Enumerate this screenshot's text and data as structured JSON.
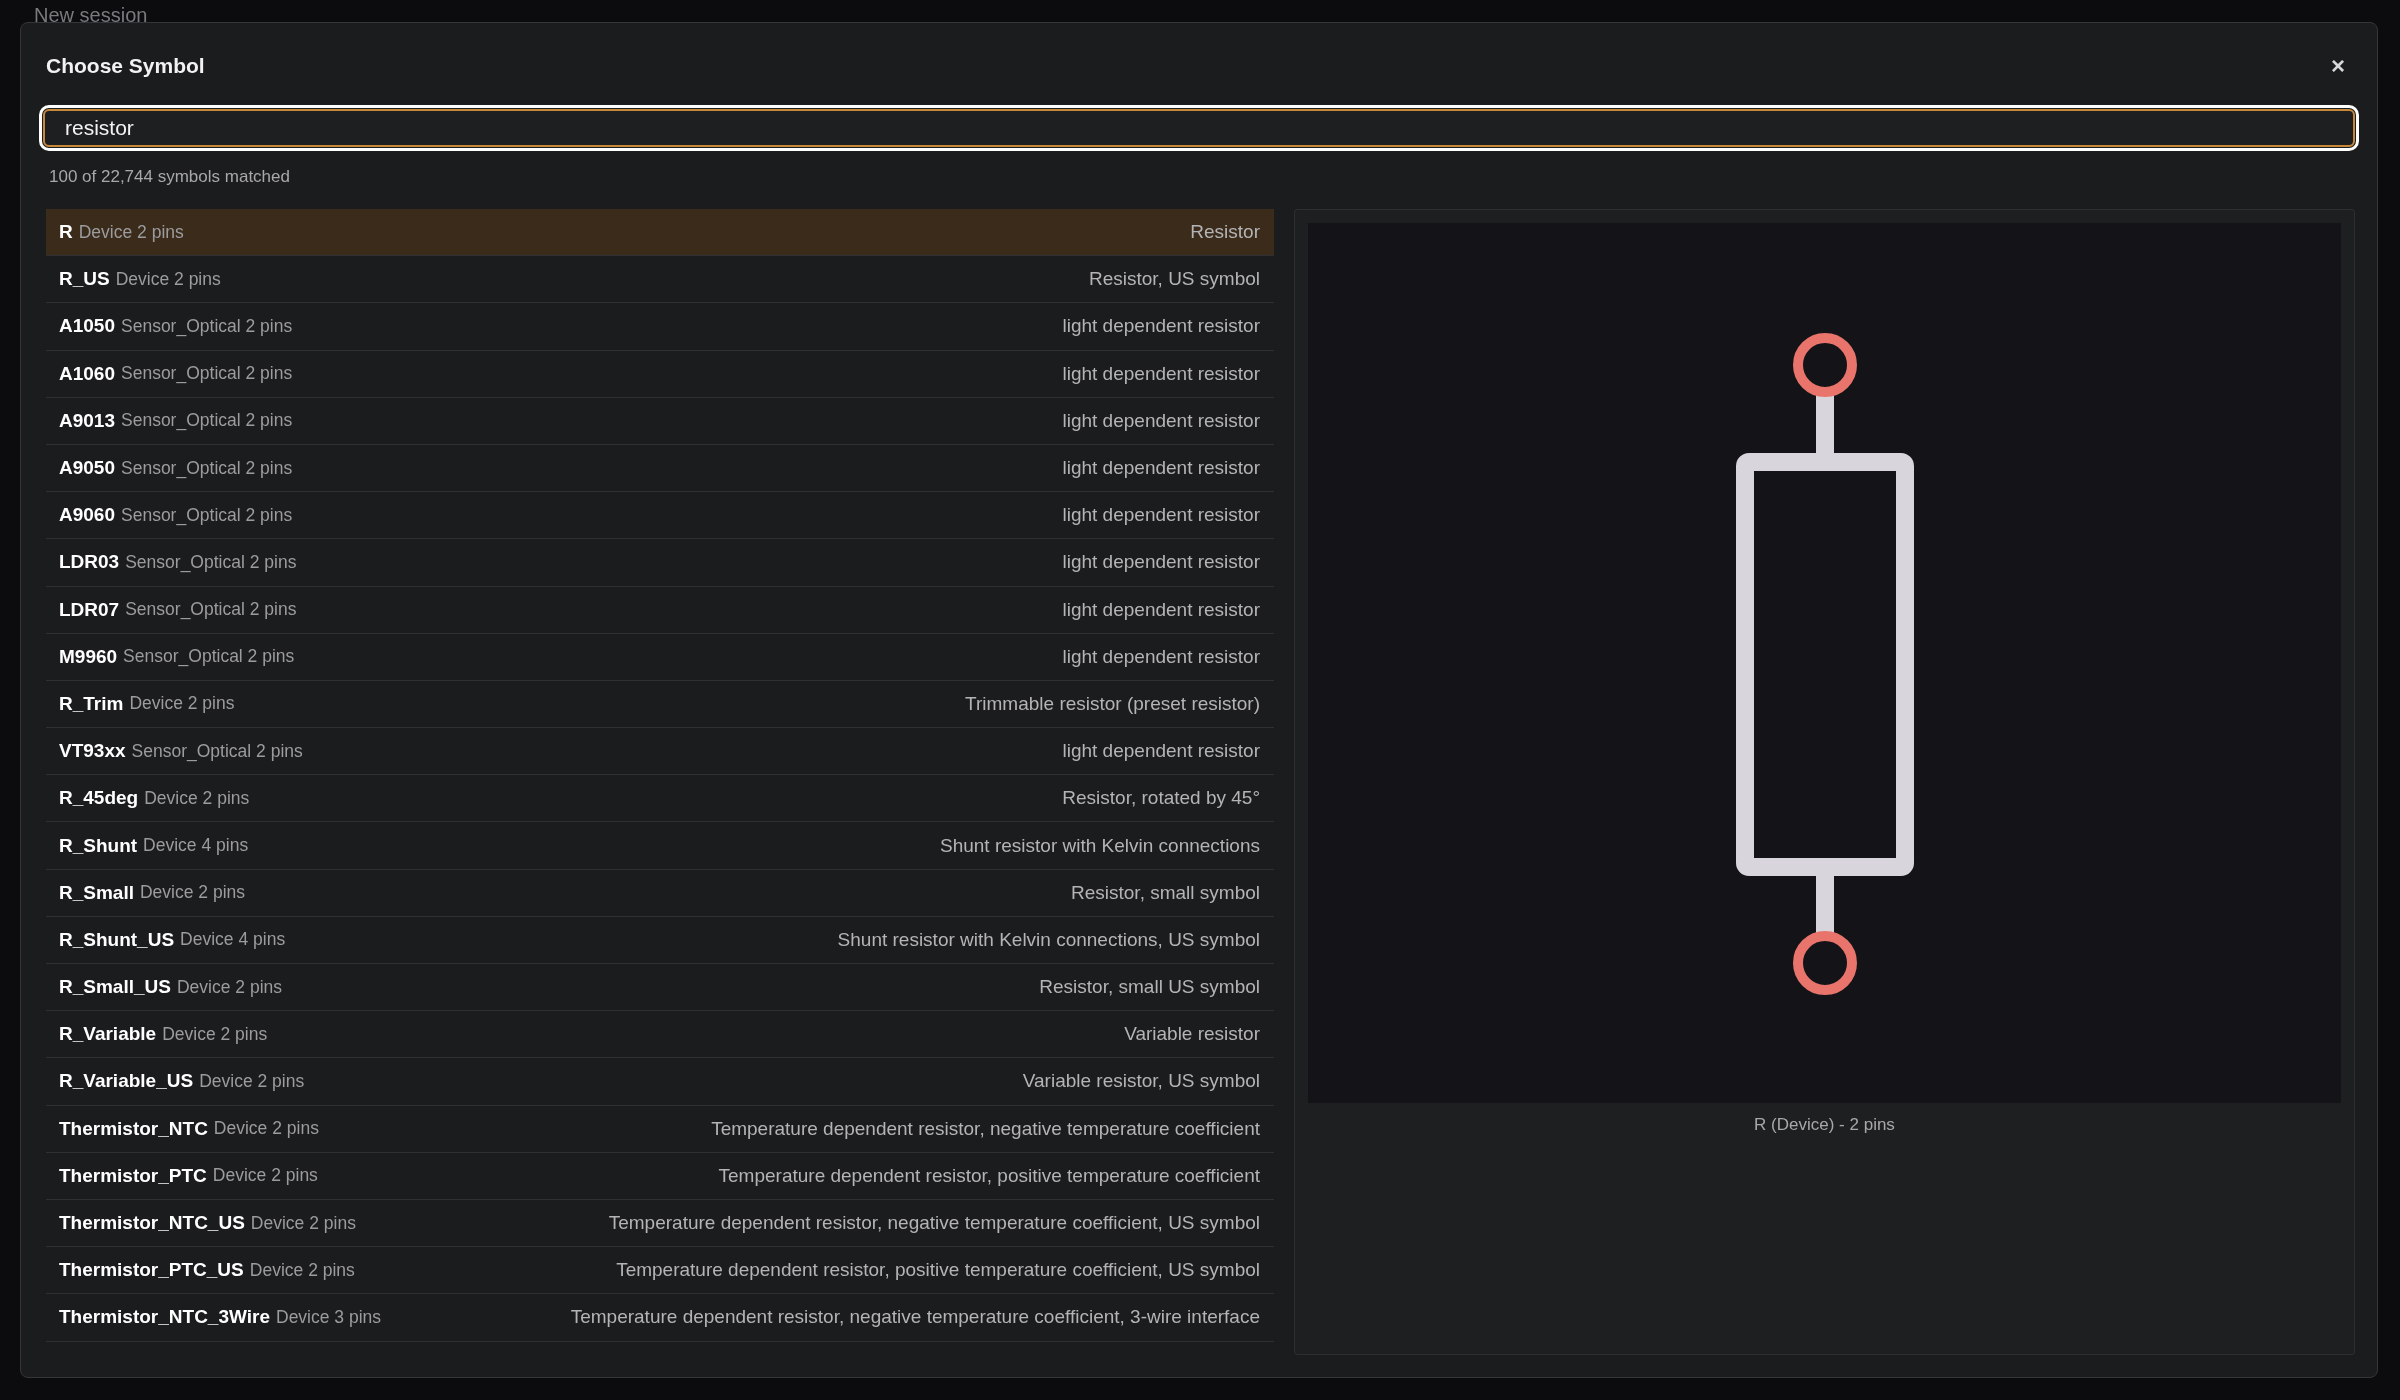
{
  "background": {
    "title": "New session"
  },
  "dialog": {
    "title": "Choose Symbol",
    "close": "×",
    "search": {
      "value": "resistor"
    },
    "match_count": "100 of 22,744 symbols matched",
    "results": [
      {
        "name": "R",
        "library": "Device 2 pins",
        "description": "Resistor",
        "selected": true
      },
      {
        "name": "R_US",
        "library": "Device 2 pins",
        "description": "Resistor, US symbol",
        "selected": false
      },
      {
        "name": "A1050",
        "library": "Sensor_Optical 2 pins",
        "description": "light dependent resistor",
        "selected": false
      },
      {
        "name": "A1060",
        "library": "Sensor_Optical 2 pins",
        "description": "light dependent resistor",
        "selected": false
      },
      {
        "name": "A9013",
        "library": "Sensor_Optical 2 pins",
        "description": "light dependent resistor",
        "selected": false
      },
      {
        "name": "A9050",
        "library": "Sensor_Optical 2 pins",
        "description": "light dependent resistor",
        "selected": false
      },
      {
        "name": "A9060",
        "library": "Sensor_Optical 2 pins",
        "description": "light dependent resistor",
        "selected": false
      },
      {
        "name": "LDR03",
        "library": "Sensor_Optical 2 pins",
        "description": "light dependent resistor",
        "selected": false
      },
      {
        "name": "LDR07",
        "library": "Sensor_Optical 2 pins",
        "description": "light dependent resistor",
        "selected": false
      },
      {
        "name": "M9960",
        "library": "Sensor_Optical 2 pins",
        "description": "light dependent resistor",
        "selected": false
      },
      {
        "name": "R_Trim",
        "library": "Device 2 pins",
        "description": "Trimmable resistor (preset resistor)",
        "selected": false
      },
      {
        "name": "VT93xx",
        "library": "Sensor_Optical 2 pins",
        "description": "light dependent resistor",
        "selected": false
      },
      {
        "name": "R_45deg",
        "library": "Device 2 pins",
        "description": "Resistor, rotated by 45°",
        "selected": false
      },
      {
        "name": "R_Shunt",
        "library": "Device 4 pins",
        "description": "Shunt resistor with Kelvin connections",
        "selected": false
      },
      {
        "name": "R_Small",
        "library": "Device 2 pins",
        "description": "Resistor, small symbol",
        "selected": false
      },
      {
        "name": "R_Shunt_US",
        "library": "Device 4 pins",
        "description": "Shunt resistor with Kelvin connections, US symbol",
        "selected": false
      },
      {
        "name": "R_Small_US",
        "library": "Device 2 pins",
        "description": "Resistor, small US symbol",
        "selected": false
      },
      {
        "name": "R_Variable",
        "library": "Device 2 pins",
        "description": "Variable resistor",
        "selected": false
      },
      {
        "name": "R_Variable_US",
        "library": "Device 2 pins",
        "description": "Variable resistor, US symbol",
        "selected": false
      },
      {
        "name": "Thermistor_NTC",
        "library": "Device 2 pins",
        "description": "Temperature dependent resistor, negative temperature coefficient",
        "selected": false
      },
      {
        "name": "Thermistor_PTC",
        "library": "Device 2 pins",
        "description": "Temperature dependent resistor, positive temperature coefficient",
        "selected": false
      },
      {
        "name": "Thermistor_NTC_US",
        "library": "Device 2 pins",
        "description": "Temperature dependent resistor, negative temperature coefficient, US symbol",
        "selected": false
      },
      {
        "name": "Thermistor_PTC_US",
        "library": "Device 2 pins",
        "description": "Temperature dependent resistor, positive temperature coefficient, US symbol",
        "selected": false
      },
      {
        "name": "Thermistor_NTC_3Wire",
        "library": "Device 3 pins",
        "description": "Temperature dependent resistor, negative temperature coefficient, 3-wire interface",
        "selected": false
      }
    ],
    "preview": {
      "caption": "R (Device) - 2 pins"
    }
  }
}
